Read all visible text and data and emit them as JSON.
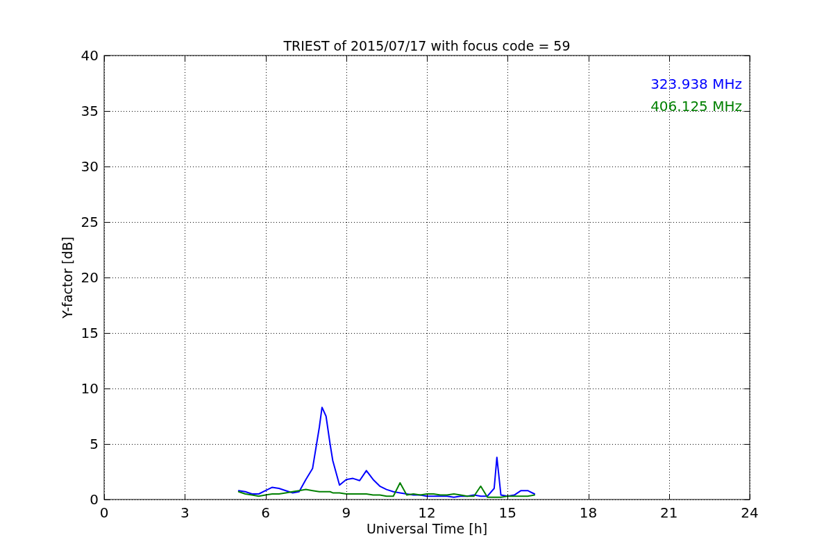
{
  "figure": {
    "chart_data": {
      "type": "line",
      "title": "TRIEST of 2015/07/17 with focus code = 59",
      "xlabel": "Universal Time [h]",
      "ylabel": "Y-factor [dB]",
      "x": [
        5,
        5.25,
        5.5,
        5.75,
        6,
        6.25,
        6.5,
        6.75,
        7,
        7.25,
        7.5,
        7.75,
        8,
        8.1,
        8.25,
        8.4,
        8.5,
        8.75,
        9,
        9.25,
        9.5,
        9.75,
        10,
        10.25,
        10.5,
        10.75,
        11,
        11.25,
        11.5,
        11.75,
        12,
        12.25,
        12.5,
        12.75,
        13,
        13.25,
        13.5,
        13.75,
        14,
        14.25,
        14.5,
        14.6,
        14.75,
        15,
        15.25,
        15.5,
        15.75,
        16
      ],
      "series": [
        {
          "name": "323.938 MHz",
          "color": "#0000ff",
          "values": [
            0.8,
            0.7,
            0.5,
            0.5,
            0.8,
            1.1,
            1.0,
            0.8,
            0.6,
            0.7,
            1.8,
            2.8,
            6.5,
            8.3,
            7.5,
            5.0,
            3.5,
            1.3,
            1.8,
            1.9,
            1.7,
            2.6,
            1.8,
            1.2,
            0.9,
            0.7,
            0.6,
            0.5,
            0.4,
            0.4,
            0.3,
            0.3,
            0.3,
            0.3,
            0.2,
            0.3,
            0.3,
            0.4,
            0.3,
            0.3,
            1.0,
            3.8,
            0.4,
            0.3,
            0.4,
            0.8,
            0.8,
            0.5
          ]
        },
        {
          "name": "406.125 MHz",
          "color": "#008000",
          "values": [
            0.7,
            0.5,
            0.4,
            0.3,
            0.4,
            0.5,
            0.5,
            0.6,
            0.7,
            0.8,
            0.9,
            0.8,
            0.7,
            0.7,
            0.7,
            0.7,
            0.6,
            0.6,
            0.5,
            0.5,
            0.5,
            0.5,
            0.4,
            0.4,
            0.3,
            0.3,
            1.5,
            0.4,
            0.5,
            0.4,
            0.5,
            0.5,
            0.4,
            0.4,
            0.5,
            0.4,
            0.3,
            0.3,
            1.2,
            0.2,
            0.2,
            0.2,
            0.2,
            0.3,
            0.3,
            0.3,
            0.3,
            0.4
          ]
        }
      ],
      "xlim": [
        0,
        24
      ],
      "ylim": [
        0,
        40
      ],
      "xticks": [
        0,
        3,
        6,
        9,
        12,
        15,
        18,
        21,
        24
      ],
      "yticks": [
        0,
        5,
        10,
        15,
        20,
        25,
        30,
        35,
        40
      ],
      "grid": true
    }
  }
}
